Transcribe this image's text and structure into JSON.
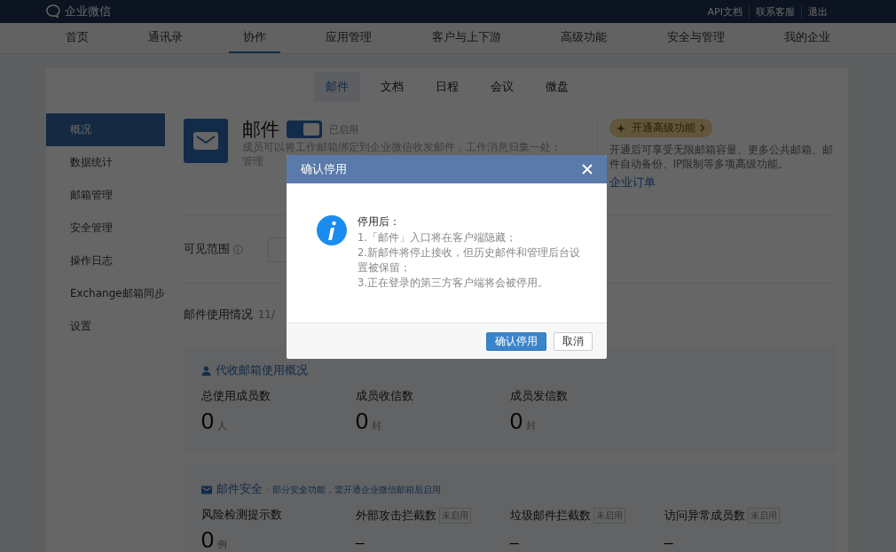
{
  "top_bar": {
    "logo_text": "企业微信",
    "links": [
      "API文档",
      "联系客服",
      "退出"
    ]
  },
  "nav": [
    {
      "label": "首页",
      "selected": false
    },
    {
      "label": "通讯录",
      "selected": false
    },
    {
      "label": "协作",
      "selected": true
    },
    {
      "label": "应用管理",
      "selected": false
    },
    {
      "label": "客户与上下游",
      "selected": false
    },
    {
      "label": "高级功能",
      "selected": false
    },
    {
      "label": "安全与管理",
      "selected": false
    },
    {
      "label": "我的企业",
      "selected": false
    }
  ],
  "subtabs": [
    {
      "label": "邮件",
      "selected": true
    },
    {
      "label": "文档",
      "selected": false
    },
    {
      "label": "日程",
      "selected": false
    },
    {
      "label": "会议",
      "selected": false
    },
    {
      "label": "微盘",
      "selected": false
    }
  ],
  "sidebar": [
    {
      "label": "概况",
      "selected": true
    },
    {
      "label": "数据统计",
      "selected": false
    },
    {
      "label": "邮箱管理",
      "selected": false
    },
    {
      "label": "安全管理",
      "selected": false
    },
    {
      "label": "操作日志",
      "selected": false
    },
    {
      "label": "Exchange邮箱同步",
      "selected": false
    },
    {
      "label": "设置",
      "selected": false
    }
  ],
  "app": {
    "title": "邮件",
    "toggle": {
      "on": true
    },
    "toggle_label": "已启用",
    "description": [
      "成员可以将工作邮箱绑定到企业微信收发邮件，工作消息归集一处；",
      "管理"
    ]
  },
  "upgrade": {
    "badge": "开通高级功能",
    "description": "开通后可享受无限邮箱容量、更多公共邮箱、邮件自动备份、IP限制等多项高级功能。",
    "link": "企业订单"
  },
  "visibility": {
    "label": "可见范围"
  },
  "usage": {
    "label": "邮件使用情况",
    "count": "11/"
  },
  "overview": {
    "title": "代收邮箱使用概况",
    "stats": [
      {
        "label": "总使用成员数",
        "value": "0",
        "unit": "人"
      },
      {
        "label": "成员收信数",
        "value": "0",
        "unit": "封"
      },
      {
        "label": "成员发信数",
        "value": "0",
        "unit": "封"
      }
    ]
  },
  "security": {
    "title": "邮件安全",
    "note": "· 部分安全功能，需开通企业微信邮箱后启用",
    "stats": [
      {
        "label": "风险检测提示数",
        "value": "0",
        "unit": "例"
      },
      {
        "label": "外部攻击拦截数",
        "badge": "未启用",
        "value": "–"
      },
      {
        "label": "垃圾邮件拦截数",
        "badge": "未启用",
        "value": "–"
      },
      {
        "label": "访问异常成员数",
        "badge": "未启用",
        "value": "–"
      }
    ]
  },
  "dialog": {
    "title": "确认停用",
    "heading": "停用后：",
    "lines": [
      "1.「邮件」入口将在客户端隐藏；",
      "2.新邮件将停止接收，但历史邮件和管理后台设置被保留；",
      "3.正在登录的第三方客户端将会被停用。"
    ],
    "confirm": "确认停用",
    "cancel": "取消"
  }
}
